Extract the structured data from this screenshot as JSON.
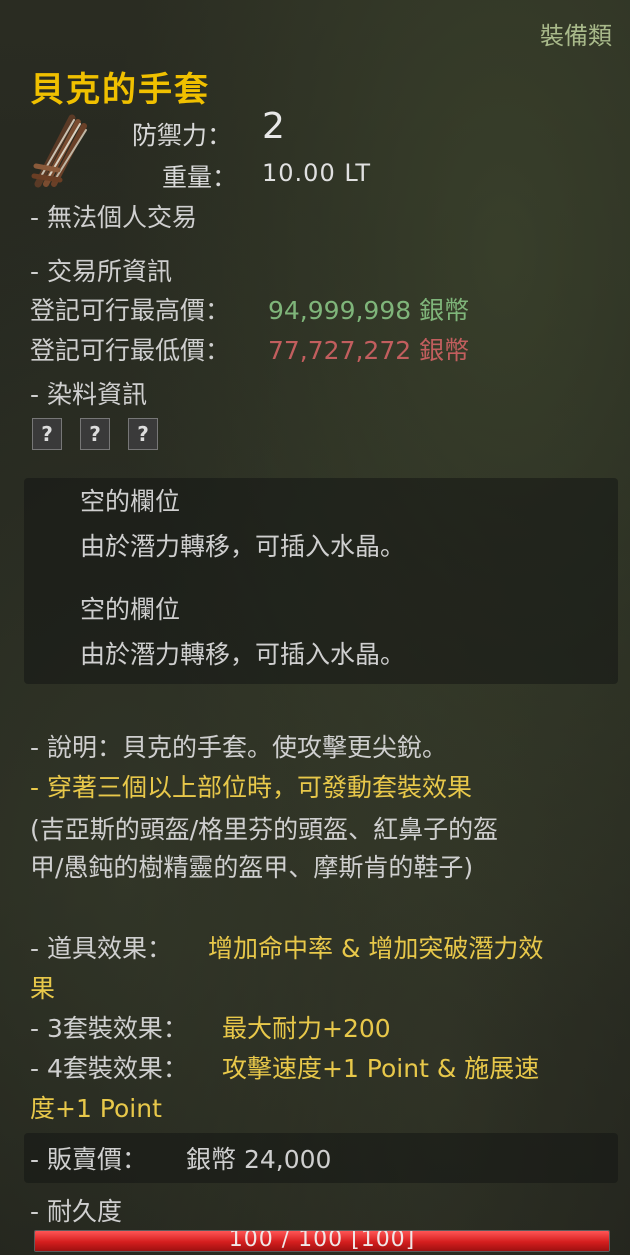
{
  "category": "裝備類",
  "item": {
    "name": "貝克的手套",
    "icon": "gloves-icon",
    "stats": {
      "defense_label": "防禦力：",
      "defense_value": "2",
      "weight_label": "重量：",
      "weight_value": "10.00 LT"
    },
    "trade_restriction": "- 無法個人交易"
  },
  "market": {
    "header": "- 交易所資訊",
    "max_label": "登記可行最高價：",
    "max_value": "94,999,998 銀幣",
    "min_label": "登記可行最低價：",
    "min_value": "77,727,272 銀幣"
  },
  "dye": {
    "header": "- 染料資訊",
    "slots": [
      "?",
      "?",
      "?"
    ]
  },
  "crystal_slots": [
    {
      "title": "空的欄位",
      "desc": "由於潛力轉移，可插入水晶。"
    },
    {
      "title": "空的欄位",
      "desc": "由於潛力轉移，可插入水晶。"
    }
  ],
  "description": {
    "text": "- 說明：貝克的手套。使攻擊更尖銳。",
    "set_condition": "- 穿著三個以上部位時，可發動套裝效果",
    "set_items_line1": "(吉亞斯的頭盔/格里芬的頭盔、紅鼻子的盔",
    "set_items_line2": "甲/愚鈍的樹精靈的盔甲、摩斯肯的鞋子)"
  },
  "effects": {
    "item_label": "- 道具效果：",
    "item_value_line1": "增加命中率 & 增加突破潛力效",
    "item_value_line2": "果",
    "set3_label": "- 3套裝效果：",
    "set3_value": "最大耐力+200",
    "set4_label": "- 4套裝效果：",
    "set4_value_line1": "攻擊速度+1 Point & 施展速",
    "set4_value_line2": "度+1 Point"
  },
  "sell": {
    "label": "- 販賣價：",
    "value": "銀幣 24,000"
  },
  "durability": {
    "label": "- 耐久度",
    "text": "100 / 100 [100]",
    "fraction": 1.0
  },
  "colors": {
    "title": "#f0c000",
    "effect": "#e8c84a",
    "max_price": "#7fb57a",
    "min_price": "#c25e5e",
    "durability_fill": "#d41e1e"
  }
}
